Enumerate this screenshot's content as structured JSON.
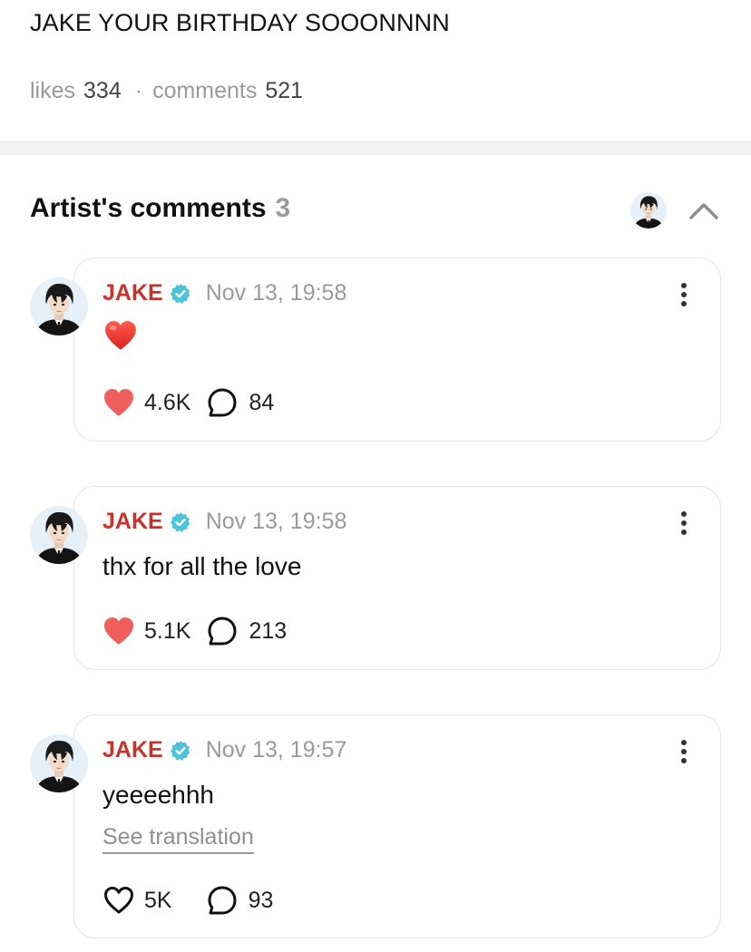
{
  "post": {
    "title": "JAKE YOUR BIRTHDAY SOOONNNN",
    "likes_label": "likes",
    "likes_count": "334",
    "separator": "·",
    "comments_label": "comments",
    "comments_count": "521"
  },
  "artist_comments": {
    "heading": "Artist's comments",
    "count": "3",
    "collapse_icon": "chevron-up-icon"
  },
  "colors": {
    "author": "#c7332c",
    "verified": "#4cc3d9",
    "heart_filled": "#ef5f5b",
    "muted_text": "#9a9a9a"
  },
  "comments": [
    {
      "author": "JAKE",
      "timestamp": "Nov 13, 19:58",
      "body": "",
      "body_emoji": "red-heart-emoji",
      "liked": true,
      "like_count": "4.6K",
      "reply_count": "84"
    },
    {
      "author": "JAKE",
      "timestamp": "Nov 13, 19:58",
      "body": "thx for all the love",
      "liked": true,
      "like_count": "5.1K",
      "reply_count": "213"
    },
    {
      "author": "JAKE",
      "timestamp": "Nov 13, 19:57",
      "body": "yeeeehhh",
      "translation_link": "See translation",
      "liked": false,
      "like_count": "5K",
      "reply_count": "93"
    }
  ]
}
